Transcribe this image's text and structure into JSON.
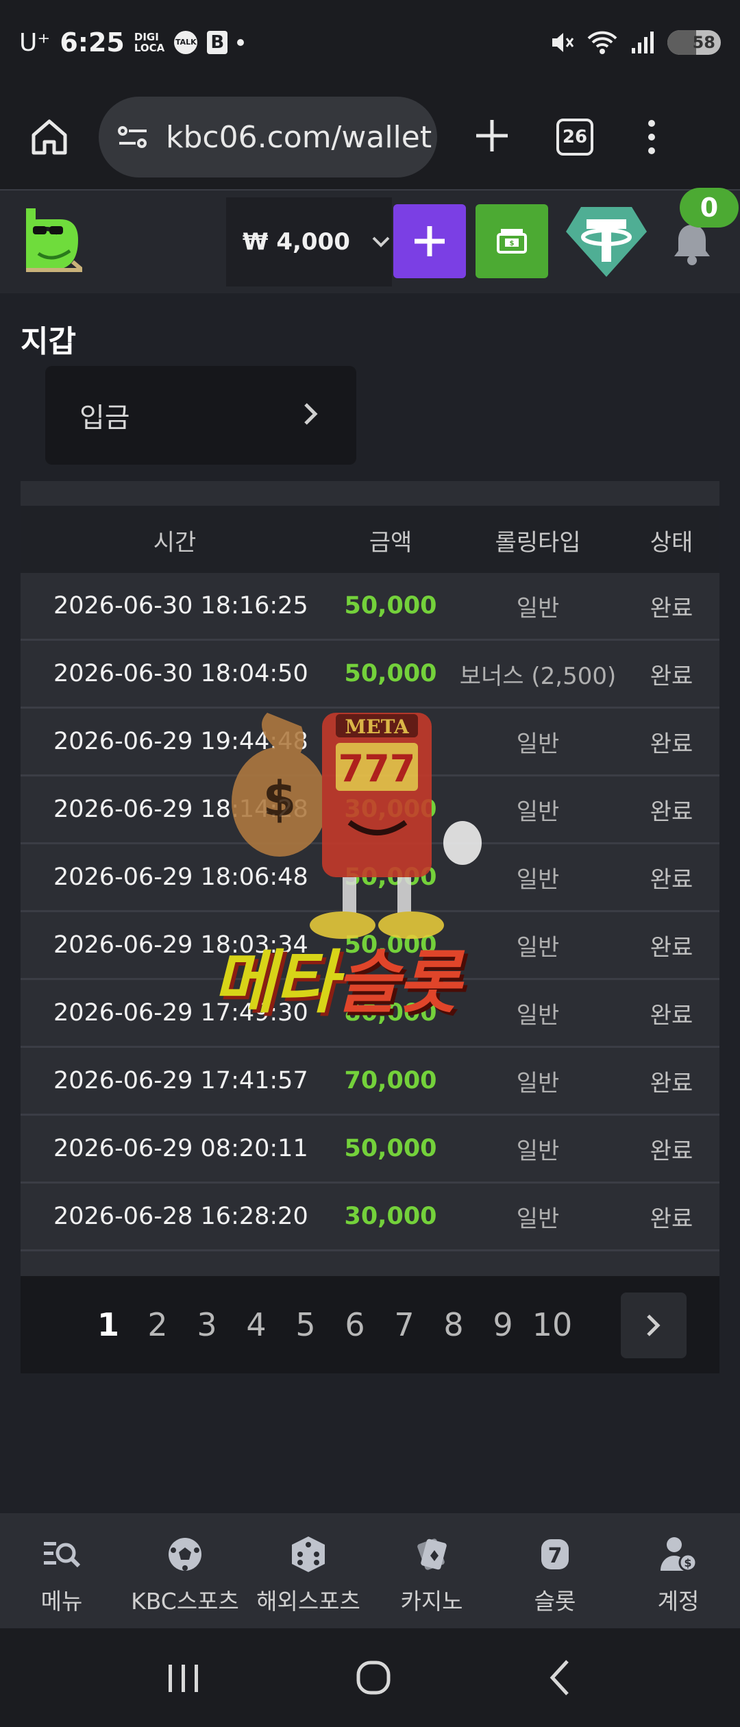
{
  "status_bar": {
    "carrier": "U⁺",
    "time": "6:25",
    "app_icons": [
      "digi-loca-icon",
      "talk-icon",
      "blog-icon"
    ],
    "digi_label": "DIGI\nLOCA",
    "talk_label": "TALK",
    "b_label": "B",
    "battery": "58"
  },
  "browser": {
    "url": "kbc06.com/wallet",
    "tab_count": "26"
  },
  "header": {
    "currency": "₩",
    "balance": "₩ 4,000",
    "plus_label": "+",
    "bell_badge": "0"
  },
  "wallet": {
    "title": "지갑",
    "deposit_label": "입금"
  },
  "table": {
    "headers": {
      "time": "시간",
      "amount": "금액",
      "rolling_type": "롤링타입",
      "status": "상태"
    },
    "rows": [
      {
        "time": "2026-06-30 18:16:25",
        "amount": "50,000",
        "type": "일반",
        "status": "완료"
      },
      {
        "time": "2026-06-30 18:04:50",
        "amount": "50,000",
        "type": "보너스 (2,500)",
        "status": "완료"
      },
      {
        "time": "2026-06-29 19:44:48",
        "amount": "",
        "type": "일반",
        "status": "완료"
      },
      {
        "time": "2026-06-29 18:14:28",
        "amount": "30,000",
        "type": "일반",
        "status": "완료"
      },
      {
        "time": "2026-06-29 18:06:48",
        "amount": "50,000",
        "type": "일반",
        "status": "완료"
      },
      {
        "time": "2026-06-29 18:03:34",
        "amount": "50,000",
        "type": "일반",
        "status": "완료"
      },
      {
        "time": "2026-06-29 17:49:30",
        "amount": "80,000",
        "type": "일반",
        "status": "완료"
      },
      {
        "time": "2026-06-29 17:41:57",
        "amount": "70,000",
        "type": "일반",
        "status": "완료"
      },
      {
        "time": "2026-06-29 08:20:11",
        "amount": "50,000",
        "type": "일반",
        "status": "완료"
      },
      {
        "time": "2026-06-28 16:28:20",
        "amount": "30,000",
        "type": "일반",
        "status": "완료"
      }
    ]
  },
  "pagination": {
    "pages": [
      "1",
      "2",
      "3",
      "4",
      "5",
      "6",
      "7",
      "8",
      "9",
      "10"
    ],
    "current": "1"
  },
  "watermark": {
    "sign": "META",
    "reels": "777",
    "text_part1": "메타",
    "text_part2": "슬롯"
  },
  "bottom_nav": [
    {
      "label": "메뉴",
      "icon": "menu-search-icon"
    },
    {
      "label": "KBC스포츠",
      "icon": "soccer-ball-icon"
    },
    {
      "label": "해외스포츠",
      "icon": "dice-icon"
    },
    {
      "label": "카지노",
      "icon": "cards-icon"
    },
    {
      "label": "슬롯",
      "icon": "slot-seven-icon"
    },
    {
      "label": "계정",
      "icon": "account-icon"
    }
  ],
  "colors": {
    "background": "#1f2127",
    "row_bg": "#2c2e34",
    "amount_green": "#74d13b",
    "purple_button": "#7b3fe4",
    "green_button": "#4caa33",
    "tether": "#4fae94"
  }
}
